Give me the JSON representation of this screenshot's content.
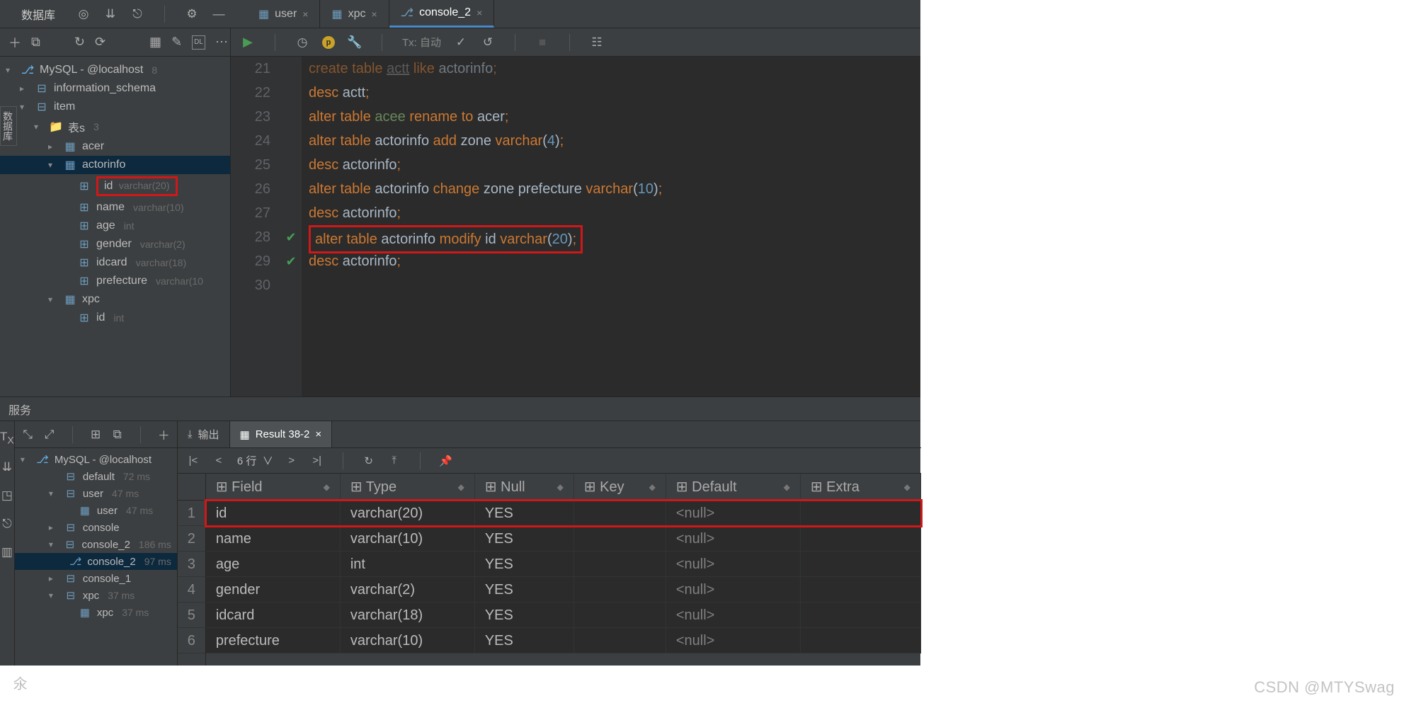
{
  "panes": {
    "db_title": "数据库",
    "svc_title": "服务"
  },
  "top_tabs": [
    {
      "label": "user"
    },
    {
      "label": "xpc"
    },
    {
      "label": "console_2",
      "active": true
    }
  ],
  "db_tree": {
    "root": "MySQL - @localhost",
    "root_badge": "8",
    "info": "information_schema",
    "item": "item",
    "tables_label": "表s",
    "tables_badge": "3",
    "acer": "acer",
    "actorinfo": "actorinfo",
    "cols": [
      {
        "name": "id",
        "type": "varchar(20)",
        "boxed": true
      },
      {
        "name": "name",
        "type": "varchar(10)"
      },
      {
        "name": "age",
        "type": "int"
      },
      {
        "name": "gender",
        "type": "varchar(2)"
      },
      {
        "name": "idcard",
        "type": "varchar(18)"
      },
      {
        "name": "prefecture",
        "type": "varchar(10"
      }
    ],
    "xpc": "xpc",
    "xpc_id": "id",
    "xpc_id_type": "int"
  },
  "editor_toolbar": {
    "tx_label": "Tx: 自动"
  },
  "code_lines": [
    {
      "n": 21,
      "html": "<span class='kw'>create</span> <span class='kw'>table</span> <span class='cm'>actt</span> <span class='kw'>like</span> actorinfo<span class='semi'>;</span>",
      "faded": true
    },
    {
      "n": 22,
      "html": "<span class='kw'>desc</span> actt<span class='semi'>;</span>"
    },
    {
      "n": 23,
      "html": "<span class='kw'>alter</span> <span class='kw'>table</span> <span class='idg'>acee</span> <span class='kw'>rename to</span> acer<span class='semi'>;</span>"
    },
    {
      "n": 24,
      "html": "<span class='kw'>alter</span> <span class='kw'>table</span> actorinfo <span class='kw'>add</span> zone <span class='kw'>varchar</span>(<span class='num'>4</span>)<span class='semi'>;</span>"
    },
    {
      "n": 25,
      "html": "<span class='kw'>desc</span> actorinfo<span class='semi'>;</span>"
    },
    {
      "n": 26,
      "html": "<span class='kw'>alter</span> <span class='kw'>table</span> actorinfo <span class='kw'>change</span> zone prefecture <span class='kw'>varchar</span>(<span class='num'>10</span>)<span class='semi'>;</span>"
    },
    {
      "n": 27,
      "html": "<span class='kw'>desc</span> actorinfo<span class='semi'>;</span>"
    },
    {
      "n": 28,
      "html": "<span class='kw'>alter</span> <span class='kw'>table</span> actorinfo <span class='kw'>modify</span> id <span class='kw'>varchar</span>(<span class='num'>20</span>)<span class='semi'>;</span>",
      "ok": true,
      "boxed": true
    },
    {
      "n": 29,
      "html": "<span class='kw'>desc</span> actorinfo<span class='semi'>;</span>",
      "ok": true
    },
    {
      "n": 30,
      "html": ""
    }
  ],
  "svc_tree": {
    "root": "MySQL - @localhost",
    "nodes": [
      {
        "label": "default",
        "dim": "72 ms"
      },
      {
        "label": "user",
        "dim": "47 ms",
        "arrow": "down"
      },
      {
        "label": "user",
        "dim": "47 ms",
        "leaf": true
      },
      {
        "label": "console",
        "arrow": "right"
      },
      {
        "label": "console_2",
        "dim": "186 ms",
        "arrow": "down"
      },
      {
        "label": "console_2",
        "dim": "97 ms",
        "leaf": true,
        "hl": true
      },
      {
        "label": "console_1",
        "arrow": "right"
      },
      {
        "label": "xpc",
        "dim": "37 ms",
        "arrow": "down"
      },
      {
        "label": "xpc",
        "dim": "37 ms",
        "leaf": true
      }
    ]
  },
  "result_tabs": {
    "out": "输出",
    "res": "Result 38-2"
  },
  "table_toolbar": {
    "pager": "6 行"
  },
  "table": {
    "headers": [
      "Field",
      "Type",
      "Null",
      "Key",
      "Default",
      "Extra"
    ],
    "rows": [
      {
        "n": 1,
        "field": "id",
        "type": "varchar(20)",
        "null": "YES",
        "key": "",
        "default": "<null>",
        "extra": "",
        "boxed": true
      },
      {
        "n": 2,
        "field": "name",
        "type": "varchar(10)",
        "null": "YES",
        "key": "",
        "default": "<null>",
        "extra": ""
      },
      {
        "n": 3,
        "field": "age",
        "type": "int",
        "null": "YES",
        "key": "",
        "default": "<null>",
        "extra": ""
      },
      {
        "n": 4,
        "field": "gender",
        "type": "varchar(2)",
        "null": "YES",
        "key": "",
        "default": "<null>",
        "extra": ""
      },
      {
        "n": 5,
        "field": "idcard",
        "type": "varchar(18)",
        "null": "YES",
        "key": "",
        "default": "<null>",
        "extra": ""
      },
      {
        "n": 6,
        "field": "prefecture",
        "type": "varchar(10)",
        "null": "YES",
        "key": "",
        "default": "<null>",
        "extra": ""
      }
    ]
  },
  "watermark": "CSDN @MTYSwag",
  "side_watermark": "氽"
}
